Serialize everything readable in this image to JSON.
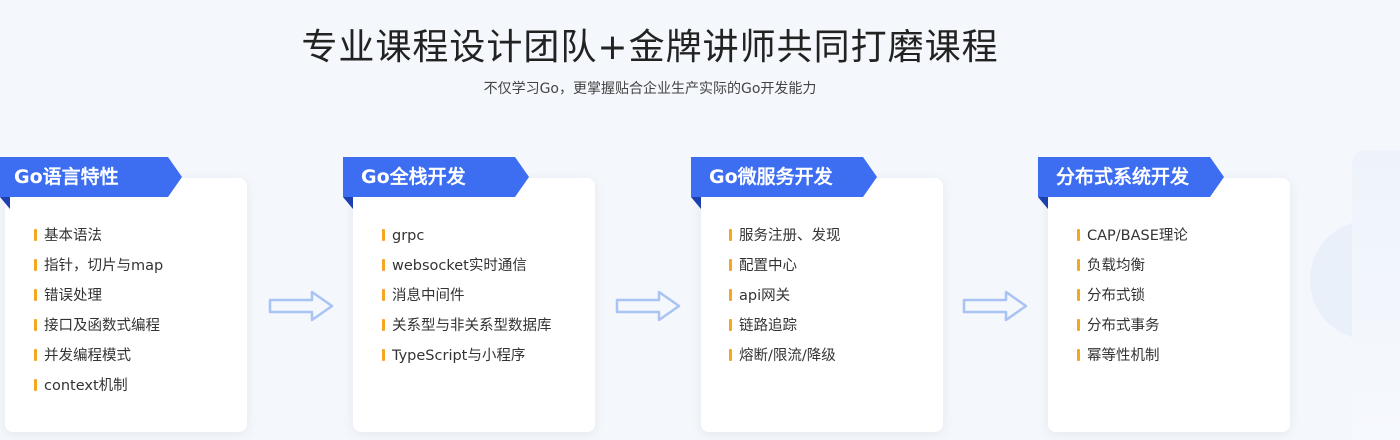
{
  "header": {
    "title": "专业课程设计团队+金牌讲师共同打磨课程",
    "subtitle": "不仅学习Go，更掌握贴合企业生产实际的Go开发能力"
  },
  "colors": {
    "accent": "#3d6ef2",
    "bullet": "#f5a623",
    "arrow": "#a9c3f5"
  },
  "arrow_icon": "right-arrow-icon",
  "cards": [
    {
      "tag": "Go语言特性",
      "items": [
        "基本语法",
        "指针，切片与map",
        "错误处理",
        "接口及函数式编程",
        "并发编程模式",
        "context机制"
      ]
    },
    {
      "tag": "Go全栈开发",
      "items": [
        "grpc",
        "websocket实时通信",
        "消息中间件",
        "关系型与非关系型数据库",
        "TypeScript与小程序"
      ]
    },
    {
      "tag": "Go微服务开发",
      "items": [
        "服务注册、发现",
        "配置中心",
        "api网关",
        "链路追踪",
        "熔断/限流/降级"
      ]
    },
    {
      "tag": "分布式系统开发",
      "items": [
        "CAP/BASE理论",
        "负载均衡",
        "分布式锁",
        "分布式事务",
        "幂等性机制"
      ]
    }
  ]
}
